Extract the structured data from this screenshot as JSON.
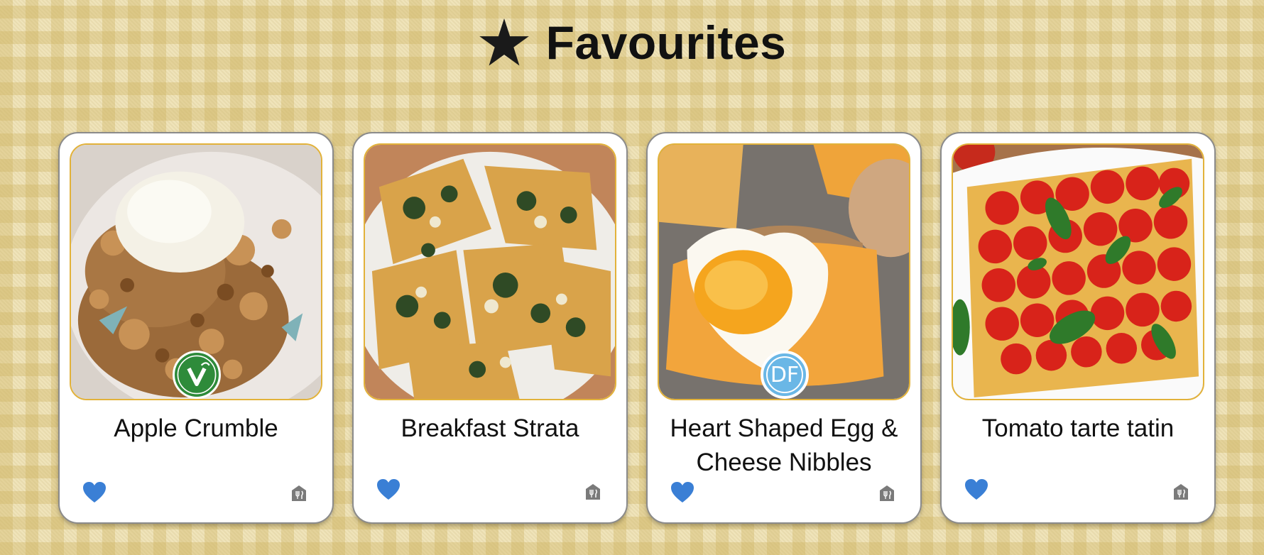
{
  "header": {
    "title": "Favourites",
    "icon": "star-icon"
  },
  "cards": [
    {
      "title": "Apple Crumble",
      "badge": "vegetarian-friendly",
      "favourited": true
    },
    {
      "title": "Breakfast Strata",
      "badge": null,
      "favourited": true
    },
    {
      "title": "Heart Shaped Egg & Cheese Nibbles",
      "badge": "DF",
      "favourited": true
    },
    {
      "title": "Tomato tarte tatin",
      "badge": null,
      "favourited": true
    }
  ],
  "badges": {
    "vegetarian": "VEGETARIAN FRIENDLY",
    "dairy_free": "DF"
  },
  "colors": {
    "heart": "#3a7fd5",
    "photo_border": "#e2b23a",
    "card_icon": "#7a7a7a"
  }
}
